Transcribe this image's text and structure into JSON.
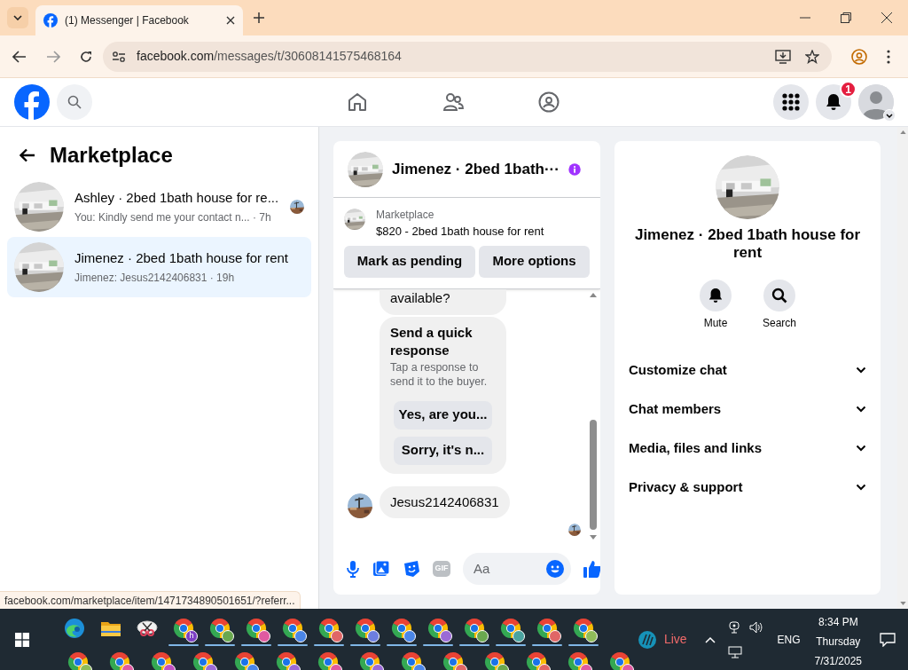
{
  "browser": {
    "tab_title": "(1) Messenger | Facebook",
    "url_host": "facebook.com",
    "url_path": "/messages/t/30608141575468164",
    "status_url": "facebook.com/marketplace/item/1471734890501651/?referr..."
  },
  "header": {
    "notification_count": "1"
  },
  "sidebar": {
    "title": "Marketplace",
    "conversations": [
      {
        "name": "Ashley · 2bed 1bath house for re...",
        "preview": "You: Kindly send me your contact n... · 7h",
        "selected": false,
        "seen": true
      },
      {
        "name": "Jimenez · 2bed 1bath house for rent",
        "preview": "Jimenez: Jesus2142406831 · 19h",
        "selected": true,
        "seen": false
      }
    ]
  },
  "chat": {
    "title": "Jimenez · 2bed 1bath···",
    "listing": {
      "label": "Marketplace",
      "title": "$820 - 2bed 1bath house for rent"
    },
    "actions": [
      "Mark as pending",
      "More options"
    ],
    "messages": [
      {
        "kind": "text",
        "text": "available?",
        "avatar": false
      },
      {
        "kind": "quick_response",
        "title": "Send a quick response",
        "subtitle": "Tap a response to send it to the buyer.",
        "options": [
          "Yes, are you...",
          "Sorry, it's n..."
        ]
      },
      {
        "kind": "text",
        "text": "Jesus2142406831",
        "avatar": true
      }
    ],
    "composer": {
      "gif_label": "GIF",
      "placeholder": "Aa"
    }
  },
  "details": {
    "title": "Jimenez · 2bed 1bath house for rent",
    "actions": [
      {
        "kind": "mute",
        "label": "Mute"
      },
      {
        "kind": "search",
        "label": "Search"
      }
    ],
    "sections": [
      "Customize chat",
      "Chat members",
      "Media, files and links",
      "Privacy & support"
    ]
  },
  "taskbar": {
    "rows": [
      [
        {
          "kind": "edge",
          "running": false
        },
        {
          "kind": "folder",
          "running": false
        },
        {
          "kind": "snip",
          "running": false
        },
        {
          "kind": "chrome",
          "color": "#7c3fc4",
          "badge": "h",
          "running": true
        },
        {
          "kind": "chrome",
          "color": "#6aa84f",
          "running": true
        },
        {
          "kind": "chrome",
          "color": "#e05aa0",
          "running": true
        },
        {
          "kind": "chrome",
          "color": "#4a86e8",
          "running": true
        },
        {
          "kind": "chrome",
          "color": "#e06666",
          "running": true
        },
        {
          "kind": "chrome",
          "color": "#6d7ee0",
          "running": true
        },
        {
          "kind": "chrome",
          "color": "#4a86e8",
          "running": true
        },
        {
          "kind": "chrome",
          "color": "#9b6ad6",
          "running": true
        },
        {
          "kind": "chrome",
          "color": "#6aa84f",
          "running": true
        },
        {
          "kind": "chrome",
          "color": "#4aa3a0",
          "running": true
        },
        {
          "kind": "chrome",
          "color": "#e06666",
          "running": true
        },
        {
          "kind": "chrome",
          "color": "#8fbc5a",
          "running": true
        }
      ],
      [
        {
          "kind": "chrome",
          "color": "#8fbc5a",
          "running": false
        },
        {
          "kind": "chrome",
          "color": "#e05aa0",
          "running": false
        },
        {
          "kind": "chrome",
          "color": "#c050c0",
          "running": false
        },
        {
          "kind": "chrome",
          "color": "#9b6ad6",
          "running": false
        },
        {
          "kind": "chrome",
          "color": "#4a86e8",
          "running": false
        },
        {
          "kind": "chrome",
          "color": "#9b6ad6",
          "running": false
        },
        {
          "kind": "chrome",
          "color": "#e05aa0",
          "running": false
        },
        {
          "kind": "chrome",
          "color": "#9b6ad6",
          "running": false
        },
        {
          "kind": "chrome",
          "color": "#4a86e8",
          "running": false
        },
        {
          "kind": "chrome",
          "color": "#e06666",
          "running": false
        },
        {
          "kind": "chrome",
          "color": "#6aa84f",
          "running": false
        },
        {
          "kind": "chrome",
          "color": "#e06666",
          "running": false
        },
        {
          "kind": "chrome",
          "color": "#e05aa0",
          "running": false
        },
        {
          "kind": "chrome",
          "color": "#e05aa0",
          "running": false
        }
      ]
    ],
    "weather": "Live",
    "language": "ENG",
    "time": "8:34 PM",
    "day": "Thursday",
    "date": "7/31/2025"
  }
}
